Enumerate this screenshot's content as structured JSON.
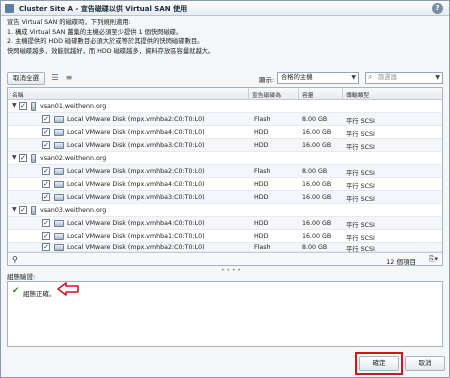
{
  "window": {
    "title": "Cluster Site A - 宣告磁碟以供 Virtual SAN 使用"
  },
  "instructions": [
    "宣告 Virtual SAN 的磁碟時，下列規則適用:",
    "1. 構成 Virtual SAN 叢集的主機必須至少提供 1 個快閃磁碟。",
    "2. 主機提供的 HDD 磁碟數目必須大於或等於其提供的快閃磁碟數目。",
    "快閃磁碟越多，效能就越好，而 HDD 磁碟越多，資料存放區容量就越大。"
  ],
  "toolbar": {
    "deselect_all_label": "取消全選",
    "display_label": "顯示:",
    "display_value": "合格的主機",
    "search_placeholder": "篩選器"
  },
  "columns": {
    "name": "名稱",
    "claim_as": "宣告磁碟為",
    "capacity": "容量",
    "transport": "傳輸類型"
  },
  "rows": [
    {
      "kind": "host",
      "name": "vsan01.weithenn.org"
    },
    {
      "kind": "disk",
      "name": "Local VMware Disk (mpx.vmhba2:C0:T0:L0)",
      "claim": "Flash",
      "capacity": "8.00 GB",
      "transport": "平行 SCSI"
    },
    {
      "kind": "disk",
      "name": "Local VMware Disk (mpx.vmhba4:C0:T0:L0)",
      "claim": "HDD",
      "capacity": "16.00 GB",
      "transport": "平行 SCSI"
    },
    {
      "kind": "disk",
      "name": "Local VMware Disk (mpx.vmhba3:C0:T0:L0)",
      "claim": "HDD",
      "capacity": "16.00 GB",
      "transport": "平行 SCSI"
    },
    {
      "kind": "host",
      "name": "vsan02.weithenn.org"
    },
    {
      "kind": "disk",
      "name": "Local VMware Disk (mpx.vmhba2:C0:T0:L0)",
      "claim": "Flash",
      "capacity": "8.00 GB",
      "transport": "平行 SCSI"
    },
    {
      "kind": "disk",
      "name": "Local VMware Disk (mpx.vmhba4:C0:T0:L0)",
      "claim": "HDD",
      "capacity": "16.00 GB",
      "transport": "平行 SCSI"
    },
    {
      "kind": "disk",
      "name": "Local VMware Disk (mpx.vmhba3:C0:T0:L0)",
      "claim": "HDD",
      "capacity": "16.00 GB",
      "transport": "平行 SCSI"
    },
    {
      "kind": "host",
      "name": "vsan03.weithenn.org"
    },
    {
      "kind": "disk",
      "name": "Local VMware Disk (mpx.vmhba4:C0:T0:L0)",
      "claim": "HDD",
      "capacity": "16.00 GB",
      "transport": "平行 SCSI"
    },
    {
      "kind": "disk",
      "name": "Local VMware Disk (mpx.vmhba1:C0:T0:L0)",
      "claim": "HDD",
      "capacity": "16.00 GB",
      "transport": "平行 SCSI"
    },
    {
      "kind": "disk",
      "name": "Local VMware Disk (mpx.vmhba2:C0:T0:L0)",
      "claim": "Flash",
      "capacity": "8.00 GB",
      "transport": "平行 SCSI"
    }
  ],
  "footer": {
    "item_count": "12 個項目"
  },
  "validation": {
    "label": "組態驗證:",
    "message": "組態正確。"
  },
  "buttons": {
    "ok": "確定",
    "cancel": "取消"
  },
  "colors": {
    "highlight": "#d2141e",
    "check": "#2e8b2e"
  }
}
